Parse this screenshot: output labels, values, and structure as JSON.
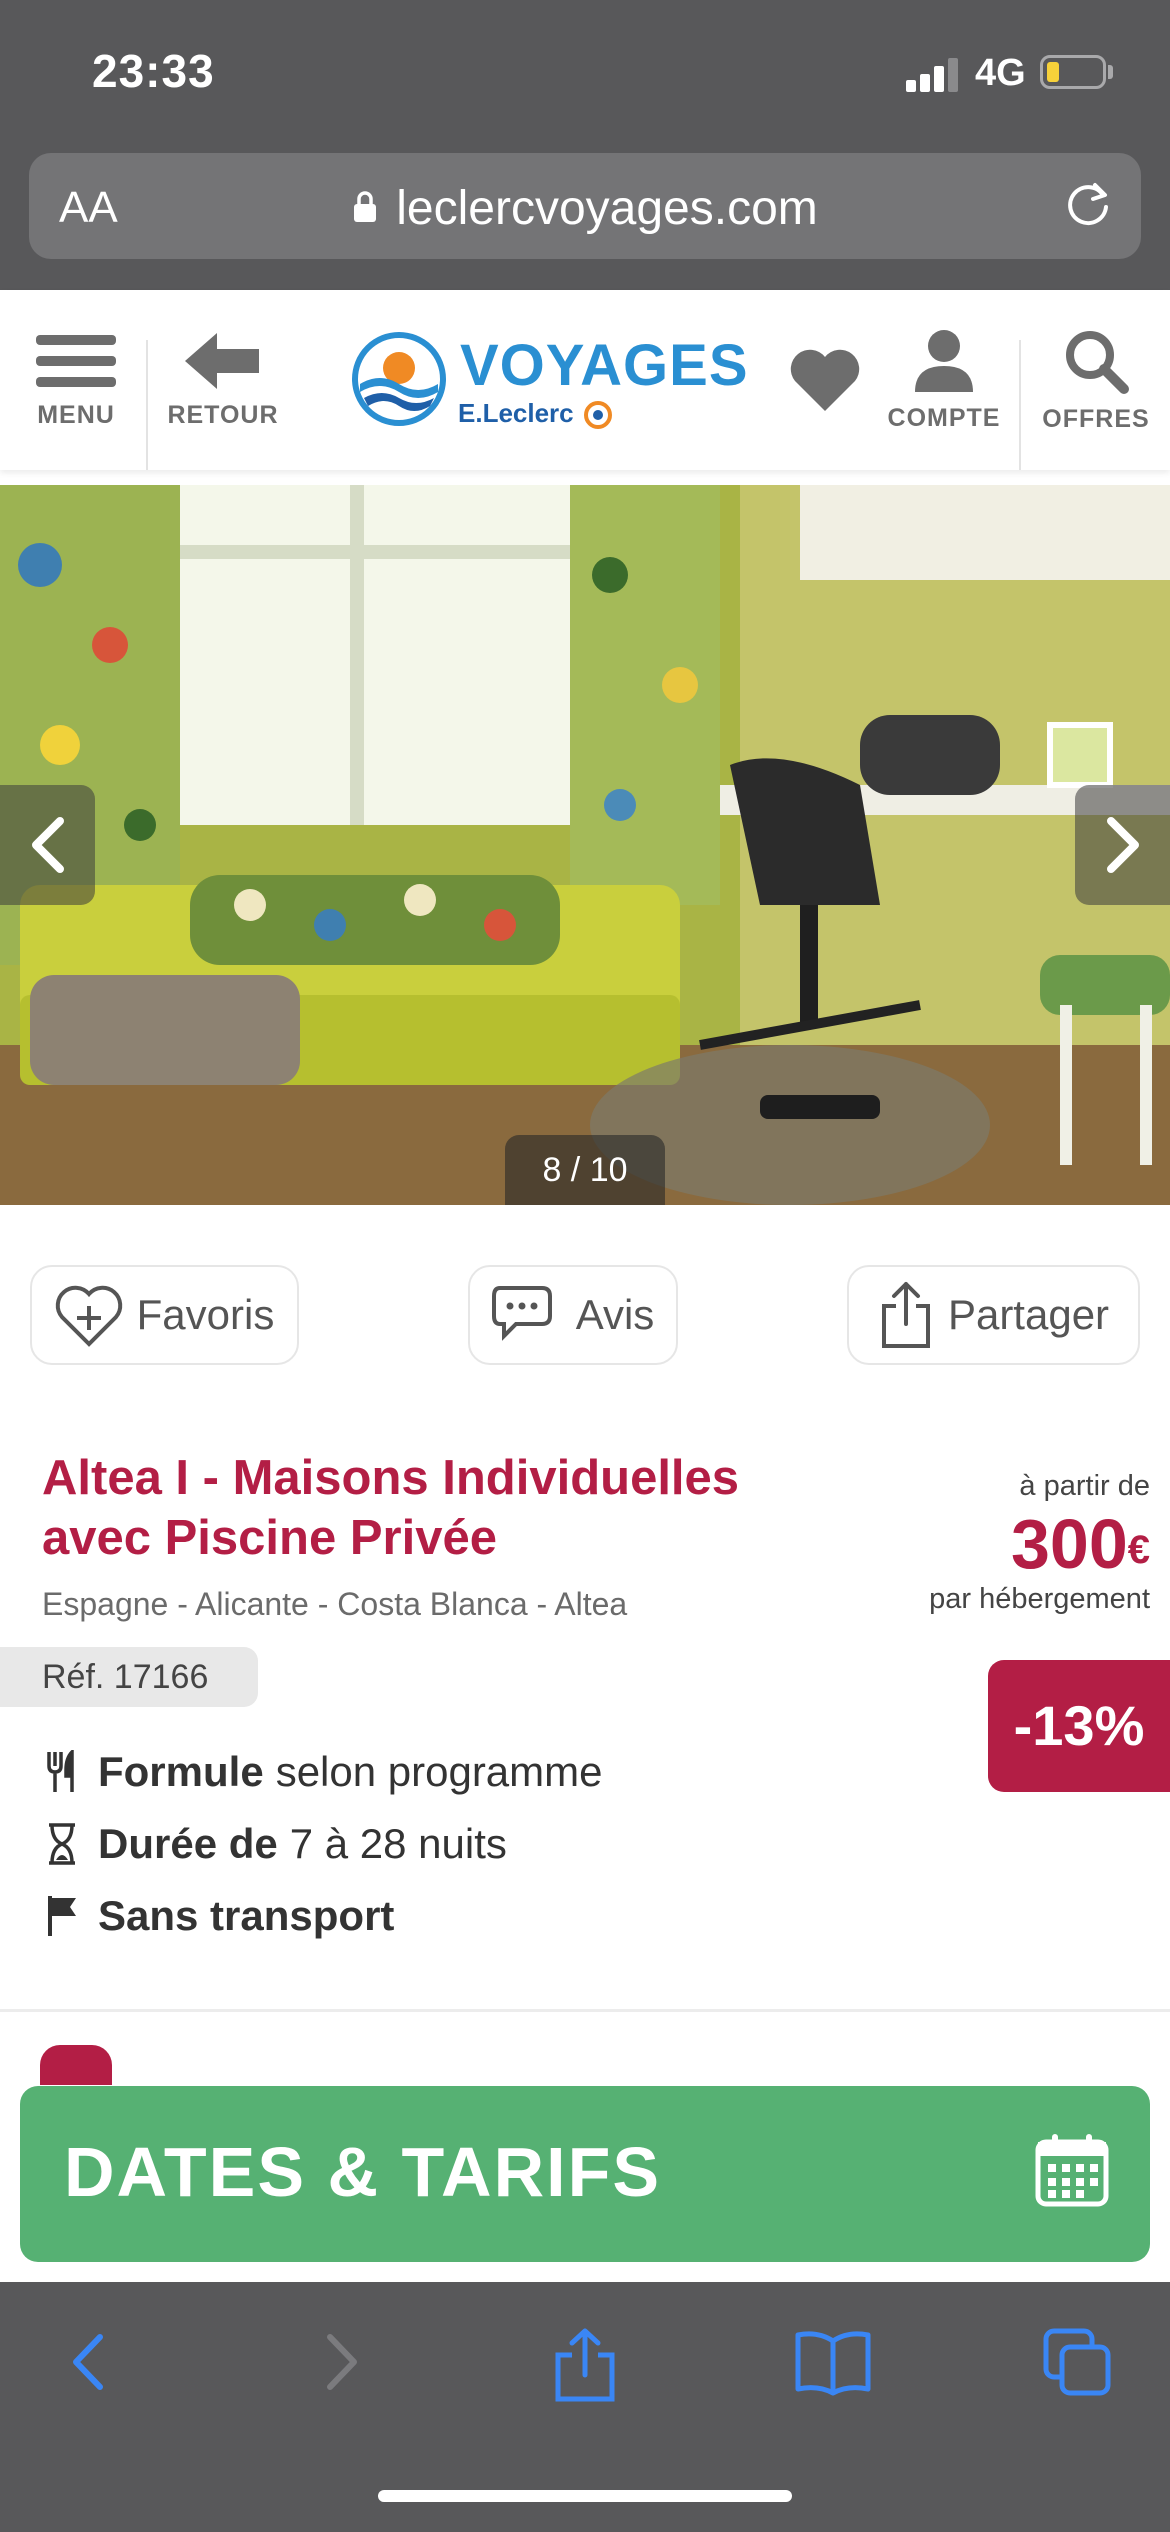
{
  "status_bar": {
    "time": "23:33",
    "network": "4G",
    "battery_level": 0.15
  },
  "browser": {
    "text_size_label": "AA",
    "url": "leclercvoyages.com"
  },
  "header": {
    "menu_label": "MENU",
    "back_label": "RETOUR",
    "logo_word": "VOYAGES",
    "logo_sub": "E.Leclerc",
    "account_label": "COMPTE",
    "offers_label": "OFFRES"
  },
  "gallery": {
    "counter": "8 / 10",
    "current": 8,
    "total": 10
  },
  "actions": {
    "favorites": "Favoris",
    "reviews": "Avis",
    "share": "Partager"
  },
  "product": {
    "title": "Altea I - Maisons Individuelles avec Piscine Privée",
    "location": "Espagne - Alicante - Costa Blanca - Altea",
    "ref": "Réf. 17166",
    "price_prefix": "à partir de",
    "price_value": "300",
    "price_currency": "€",
    "price_suffix": "par hébergement",
    "discount": "-13%"
  },
  "features": [
    {
      "icon": "cutlery-icon",
      "bold": "Formule",
      "text": "selon programme"
    },
    {
      "icon": "hourglass-icon",
      "bold": "Durée de",
      "text": "7 à 28 nuits"
    },
    {
      "icon": "flag-icon",
      "bold": "Sans transport",
      "text": ""
    }
  ],
  "cta": {
    "label": "DATES & TARIFS"
  },
  "colors": {
    "brand_red": "#b31e45",
    "cta_green": "#56b173",
    "logo_blue": "#2a8fd2",
    "ios_blue": "#3a86f5"
  }
}
